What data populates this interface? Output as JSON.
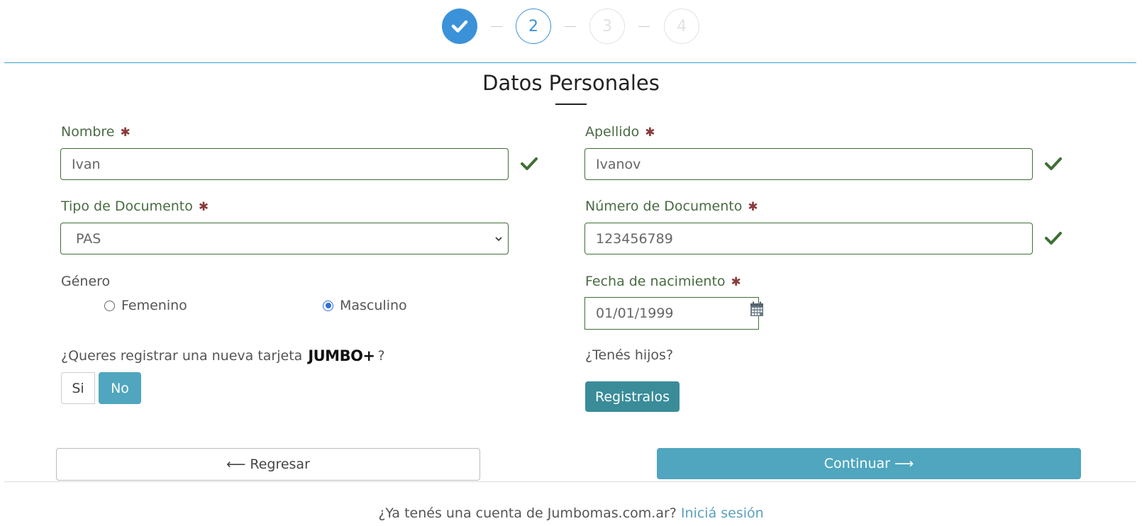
{
  "stepper": {
    "steps": [
      {
        "label": "",
        "state": "done"
      },
      {
        "label": "2",
        "state": "current"
      },
      {
        "label": "3",
        "state": "pending"
      },
      {
        "label": "4",
        "state": "pending"
      }
    ]
  },
  "page": {
    "title": "Datos Personales"
  },
  "form": {
    "nombre": {
      "label": "Nombre",
      "value": "Ivan"
    },
    "apellido": {
      "label": "Apellido",
      "value": "Ivanov"
    },
    "tipo_documento": {
      "label": "Tipo de Documento",
      "value": "PAS"
    },
    "numero_documento": {
      "label": "Número de Documento",
      "value": "123456789"
    },
    "genero": {
      "label": "Género",
      "options": [
        {
          "label": "Femenino",
          "selected": false
        },
        {
          "label": "Masculino",
          "selected": true
        }
      ]
    },
    "fecha_nacimiento": {
      "label": "Fecha de nacimiento",
      "value": "01/01/1999"
    },
    "tarjeta": {
      "question_prefix": "¿Queres registrar una nueva tarjeta",
      "logo_text": "JUMBO+",
      "question_suffix": "?",
      "yes_label": "Si",
      "no_label": "No"
    },
    "hijos": {
      "question": "¿Tenés hijos?",
      "button_label": "Registralos"
    },
    "required_mark": "✱"
  },
  "actions": {
    "back_label": "⟵ Regresar",
    "continue_label": "Continuar ⟶"
  },
  "footer": {
    "text": "¿Ya tenés una cuenta de Jumbomas.com.ar?",
    "link_label": "Iniciá sesión"
  },
  "colors": {
    "accent": "#4fa6be",
    "stepper_blue": "#3b92d9",
    "valid_green": "#3f6f35",
    "required_red": "#8b3a3a"
  }
}
